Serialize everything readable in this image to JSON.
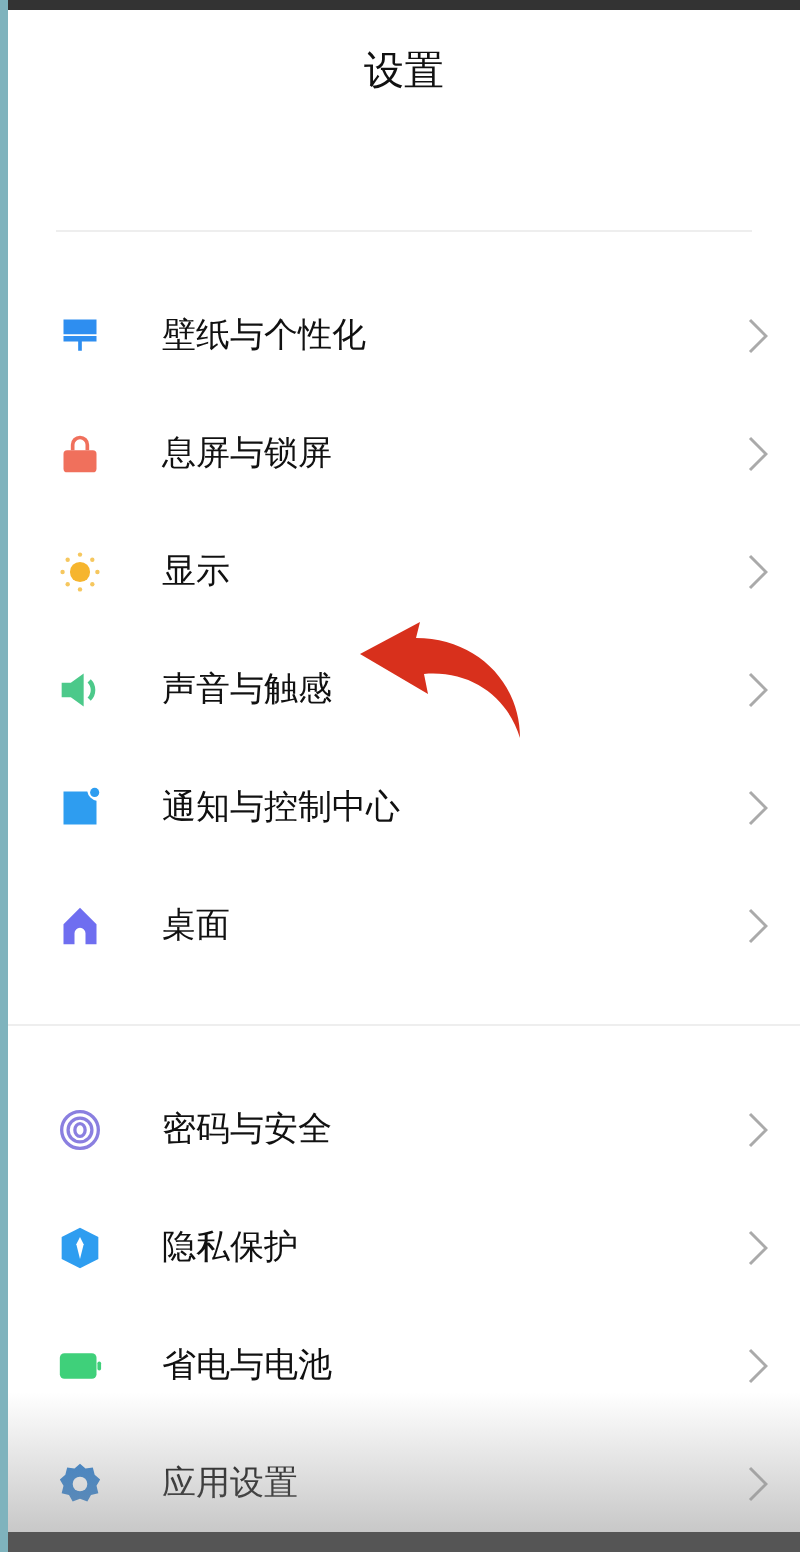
{
  "title": "设置",
  "groups": [
    {
      "items": [
        {
          "label": "壁纸与个性化",
          "kind": "wallpaper",
          "marked": false
        },
        {
          "label": "息屏与锁屏",
          "kind": "lock",
          "marked": false
        },
        {
          "label": "显示",
          "kind": "sun",
          "marked": false
        },
        {
          "label": "声音与触感",
          "kind": "speaker",
          "marked": true
        },
        {
          "label": "通知与控制中心",
          "kind": "notification",
          "marked": false
        },
        {
          "label": "桌面",
          "kind": "home",
          "marked": false
        }
      ]
    },
    {
      "items": [
        {
          "label": "密码与安全",
          "kind": "fingerprint",
          "marked": false
        },
        {
          "label": "隐私保护",
          "kind": "shield",
          "marked": false
        },
        {
          "label": "省电与电池",
          "kind": "battery",
          "marked": false
        },
        {
          "label": "应用设置",
          "kind": "gear",
          "marked": false
        }
      ]
    }
  ]
}
